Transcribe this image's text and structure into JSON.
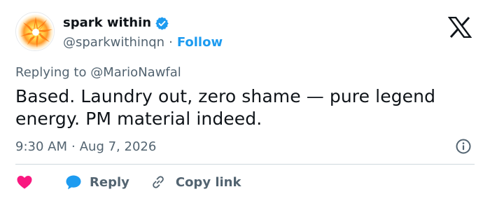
{
  "user": {
    "display_name": "spark within",
    "handle": "@sparkwithinqn",
    "separator": "·",
    "follow_label": "Follow",
    "verified": true
  },
  "tweet": {
    "replying_prefix": "Replying to",
    "replying_to": "@MarioNawfal",
    "text_lines": [
      "Based. Laundry out, zero shame — pure legend",
      "energy. PM material indeed."
    ],
    "time": "9:30 AM",
    "separator": "·",
    "date": "Aug 7, 2026"
  },
  "actions": {
    "like_icon": "heart-icon",
    "reply_label": "Reply",
    "copy_link_label": "Copy link"
  },
  "colors": {
    "accent": "#1d9bf0",
    "heart": "#f91880",
    "text_primary": "#0f1419",
    "text_secondary": "#536471",
    "divider": "#cfd9de"
  },
  "icons": [
    "spark-avatar",
    "verified-badge-icon",
    "x-logo-icon",
    "info-icon",
    "heart-icon",
    "reply-bubble-icon",
    "link-icon"
  ]
}
